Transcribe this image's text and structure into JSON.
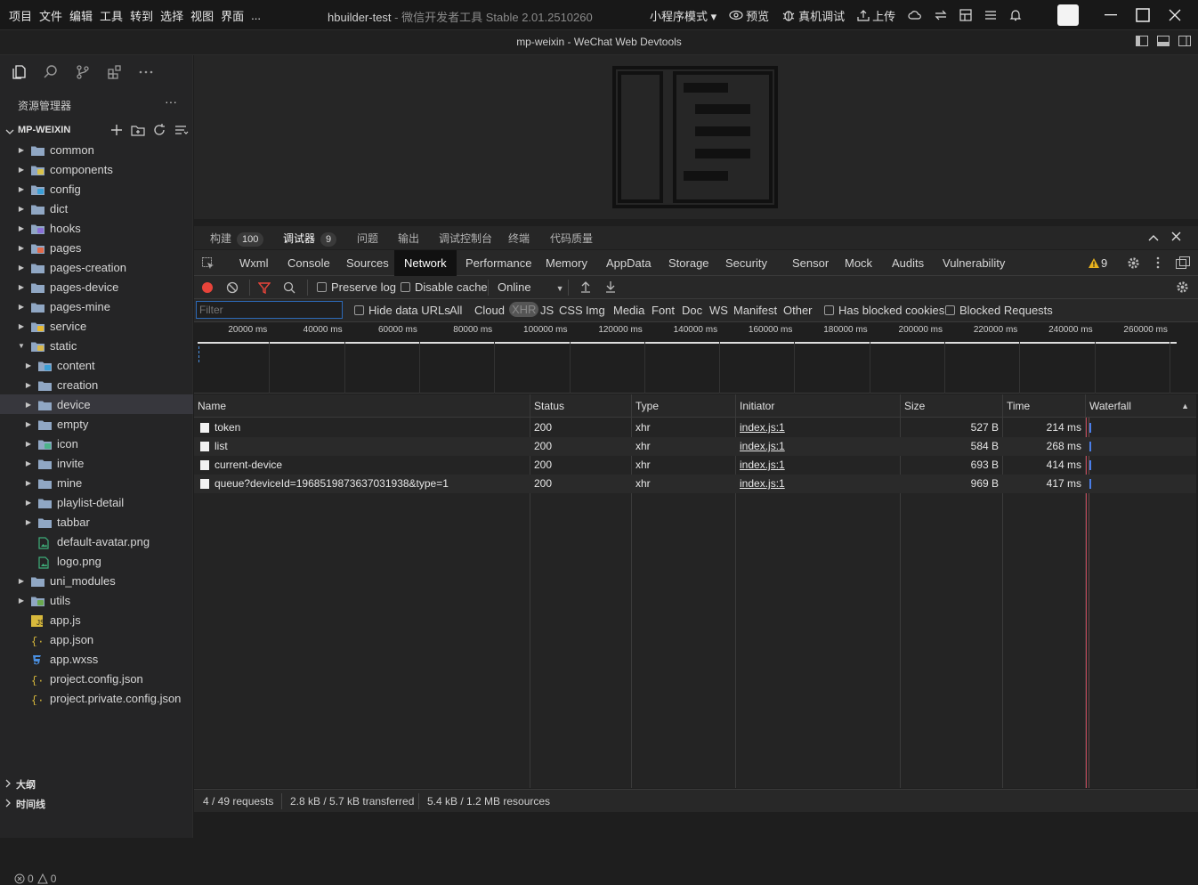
{
  "menu": [
    "项目",
    "文件",
    "编辑",
    "工具",
    "转到",
    "选择",
    "视图",
    "界面",
    "..."
  ],
  "app_title": "hbuilder-test",
  "app_subtitle": "- 微信开发者工具 Stable 2.01.2510260",
  "toolbar": {
    "mode": "小程序模式 ▾",
    "preview": "预览",
    "real_debug": "真机调试",
    "upload": "上传"
  },
  "window_subtitle": "mp-weixin - WeChat Web Devtools",
  "explorer": {
    "title": "资源管理器",
    "project": "MP-WEIXIN",
    "items": [
      {
        "label": "common",
        "kind": "folder",
        "depth": 0,
        "open": false
      },
      {
        "label": "components",
        "kind": "folder",
        "depth": 0,
        "open": false,
        "color": "#d9c24a"
      },
      {
        "label": "config",
        "kind": "folder",
        "depth": 0,
        "open": false,
        "color": "#3b9fd6"
      },
      {
        "label": "dict",
        "kind": "folder",
        "depth": 0,
        "open": false
      },
      {
        "label": "hooks",
        "kind": "folder",
        "depth": 0,
        "open": false,
        "color": "#8a6fd6"
      },
      {
        "label": "pages",
        "kind": "folder",
        "depth": 0,
        "open": false,
        "color": "#e36a4a"
      },
      {
        "label": "pages-creation",
        "kind": "folder",
        "depth": 0,
        "open": false
      },
      {
        "label": "pages-device",
        "kind": "folder",
        "depth": 0,
        "open": false
      },
      {
        "label": "pages-mine",
        "kind": "folder",
        "depth": 0,
        "open": false
      },
      {
        "label": "service",
        "kind": "folder",
        "depth": 0,
        "open": false,
        "color": "#e8b92f"
      },
      {
        "label": "static",
        "kind": "folder",
        "depth": 0,
        "open": true,
        "color": "#d9b84a"
      },
      {
        "label": "content",
        "kind": "folder",
        "depth": 1,
        "open": false,
        "color": "#3b9fd6"
      },
      {
        "label": "creation",
        "kind": "folder",
        "depth": 1,
        "open": false
      },
      {
        "label": "device",
        "kind": "folder",
        "depth": 1,
        "open": false,
        "selected": true
      },
      {
        "label": "empty",
        "kind": "folder",
        "depth": 1,
        "open": false
      },
      {
        "label": "icon",
        "kind": "folder",
        "depth": 1,
        "open": false,
        "color": "#4cb38a"
      },
      {
        "label": "invite",
        "kind": "folder",
        "depth": 1,
        "open": false
      },
      {
        "label": "mine",
        "kind": "folder",
        "depth": 1,
        "open": false
      },
      {
        "label": "playlist-detail",
        "kind": "folder",
        "depth": 1,
        "open": false
      },
      {
        "label": "tabbar",
        "kind": "folder",
        "depth": 1,
        "open": false
      },
      {
        "label": "default-avatar.png",
        "kind": "image",
        "depth": 1
      },
      {
        "label": "logo.png",
        "kind": "image",
        "depth": 1
      },
      {
        "label": "uni_modules",
        "kind": "folder",
        "depth": 0,
        "open": false
      },
      {
        "label": "utils",
        "kind": "folder",
        "depth": 0,
        "open": false,
        "color": "#6aa84f"
      },
      {
        "label": "app.js",
        "kind": "js",
        "depth": 0
      },
      {
        "label": "app.json",
        "kind": "json",
        "depth": 0
      },
      {
        "label": "app.wxss",
        "kind": "css",
        "depth": 0
      },
      {
        "label": "project.config.json",
        "kind": "json",
        "depth": 0
      },
      {
        "label": "project.private.config.json",
        "kind": "json",
        "depth": 0
      }
    ],
    "outline": "大纲",
    "timeline": "时间线",
    "status_errors": "0",
    "status_warnings": "0"
  },
  "devtools_tabs": [
    {
      "label": "构建",
      "badge": "100"
    },
    {
      "label": "调试器",
      "badge": "9",
      "active": true
    },
    {
      "label": "问题"
    },
    {
      "label": "输出"
    },
    {
      "label": "调试控制台"
    },
    {
      "label": "终端"
    },
    {
      "label": "代码质量"
    }
  ],
  "chrome_tabs": [
    "Wxml",
    "Console",
    "Sources",
    "Network",
    "Performance",
    "Memory",
    "AppData",
    "Storage",
    "Security",
    "Sensor",
    "Mock",
    "Audits",
    "Vulnerability"
  ],
  "active_chrome_tab": "Network",
  "warning_count": "9",
  "network_toolbar": {
    "preserve_log": "Preserve log",
    "disable_cache": "Disable cache",
    "throttle": "Online"
  },
  "filter": {
    "placeholder": "Filter",
    "hide_data_urls": "Hide data URLs",
    "types": [
      "All",
      "Cloud",
      "XHR",
      "JS",
      "CSS",
      "Img",
      "Media",
      "Font",
      "Doc",
      "WS",
      "Manifest",
      "Other"
    ],
    "active_type": "XHR",
    "blocked_cookies": "Has blocked cookies",
    "blocked_requests": "Blocked Requests"
  },
  "timeline_ticks": [
    "20000 ms",
    "40000 ms",
    "60000 ms",
    "80000 ms",
    "100000 ms",
    "120000 ms",
    "140000 ms",
    "160000 ms",
    "180000 ms",
    "200000 ms",
    "220000 ms",
    "240000 ms",
    "260000 ms"
  ],
  "table": {
    "columns": [
      "Name",
      "Status",
      "Type",
      "Initiator",
      "Size",
      "Time",
      "Waterfall"
    ],
    "rows": [
      {
        "name": "token",
        "status": "200",
        "type": "xhr",
        "initiator": "index.js:1",
        "size": "527 B",
        "time": "214 ms"
      },
      {
        "name": "list",
        "status": "200",
        "type": "xhr",
        "initiator": "index.js:1",
        "size": "584 B",
        "time": "268 ms"
      },
      {
        "name": "current-device",
        "status": "200",
        "type": "xhr",
        "initiator": "index.js:1",
        "size": "693 B",
        "time": "414 ms"
      },
      {
        "name": "queue?deviceId=1968519873637031938&type=1",
        "status": "200",
        "type": "xhr",
        "initiator": "index.js:1",
        "size": "969 B",
        "time": "417 ms"
      }
    ]
  },
  "summary": {
    "requests": "4 / 49 requests",
    "transferred": "2.8 kB / 5.7 kB transferred",
    "resources": "5.4 kB / 1.2 MB resources"
  }
}
